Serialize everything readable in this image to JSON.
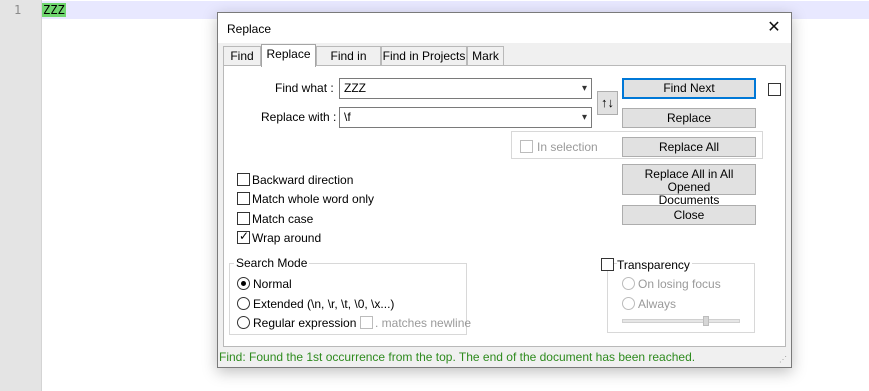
{
  "editor": {
    "line_number": "1",
    "text": "ZZZ"
  },
  "dialog": {
    "title": "Replace",
    "tabs": [
      {
        "label": "Find"
      },
      {
        "label": "Replace"
      },
      {
        "label": "Find in Files"
      },
      {
        "label": "Find in Projects"
      },
      {
        "label": "Mark"
      }
    ],
    "active_tab": "Replace",
    "find_what_label": "Find what :",
    "find_what_value": "ZZZ",
    "replace_with_label": "Replace with :",
    "replace_with_value": "\\f",
    "swap_icon": "↑↓",
    "in_selection_label": "In selection",
    "buttons": {
      "find_next": "Find Next",
      "replace": "Replace",
      "replace_all": "Replace All",
      "replace_all_opened_line1": "Replace All in All Opened",
      "replace_all_opened_line2": "Documents",
      "close": "Close"
    },
    "options": [
      {
        "label": "Backward direction",
        "checked": false
      },
      {
        "label": "Match whole word only",
        "checked": false
      },
      {
        "label": "Match case",
        "checked": false
      },
      {
        "label": "Wrap around",
        "checked": true
      }
    ],
    "search_mode": {
      "title": "Search Mode",
      "normal": "Normal",
      "extended": "Extended (\\n, \\r, \\t, \\0, \\x...)",
      "regex": "Regular expression",
      "matches_newline": ". matches newline",
      "selected": "Normal"
    },
    "transparency": {
      "title": "Transparency",
      "on_losing_focus": "On losing focus",
      "always": "Always"
    },
    "status": "Find: Found the 1st occurrence from the top. The end of the document has been reached."
  },
  "colors": {
    "match_highlight": "#6fd66f",
    "status_text": "#2e8b1e",
    "default_button_border": "#0078d7"
  }
}
